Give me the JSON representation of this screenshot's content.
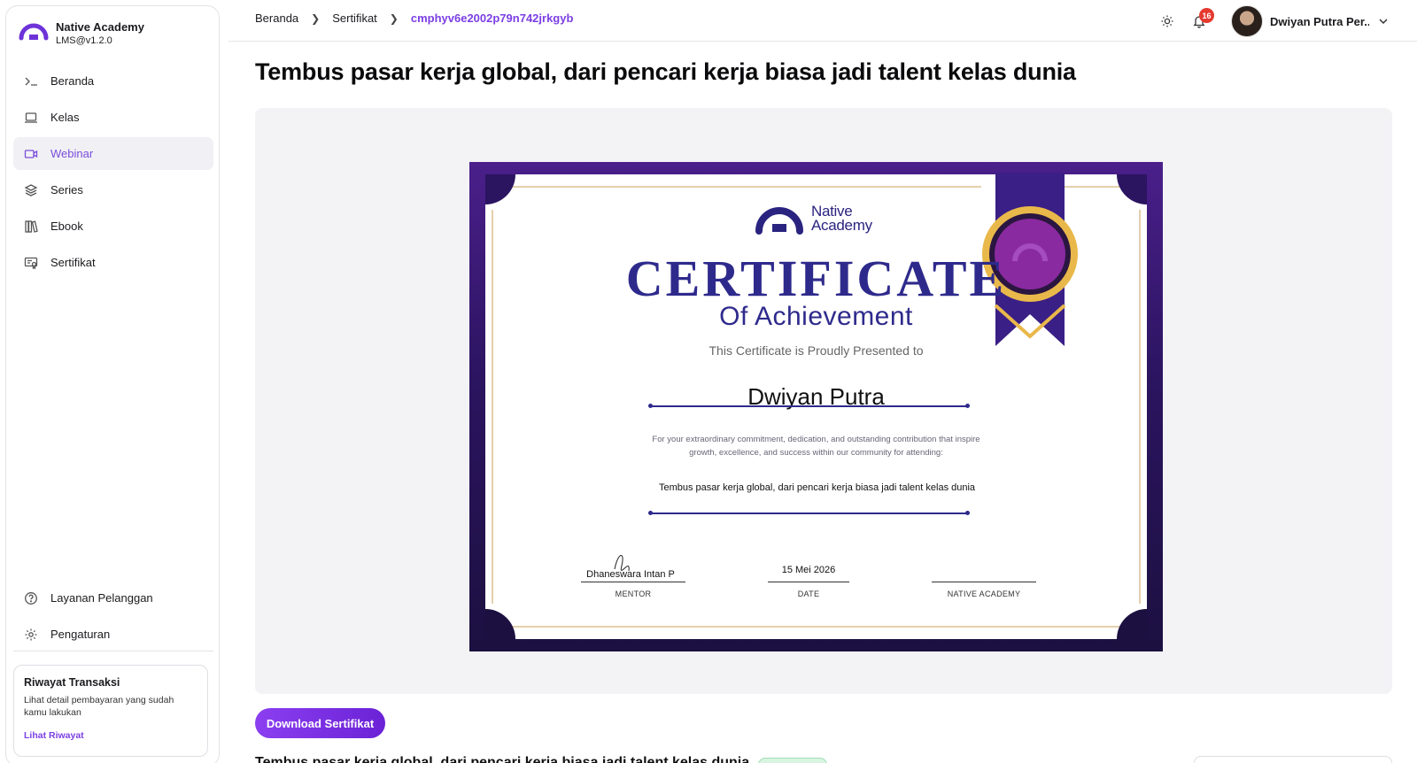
{
  "brand": {
    "name": "Native Academy",
    "version": "LMS@v1.2.0"
  },
  "sidebar": {
    "items": [
      {
        "label": "Beranda",
        "icon": "terminal-icon"
      },
      {
        "label": "Kelas",
        "icon": "laptop-icon"
      },
      {
        "label": "Webinar",
        "icon": "video-icon",
        "active": true
      },
      {
        "label": "Series",
        "icon": "layers-icon"
      },
      {
        "label": "Ebook",
        "icon": "books-icon"
      },
      {
        "label": "Sertifikat",
        "icon": "certificate-icon"
      }
    ],
    "bottom_items": [
      {
        "label": "Layanan Pelanggan",
        "icon": "help-circle-icon"
      },
      {
        "label": "Pengaturan",
        "icon": "gear-icon"
      }
    ],
    "transactions": {
      "title": "Riwayat Transaksi",
      "description": "Lihat detail pembayaran yang sudah kamu lakukan",
      "link": "Lihat Riwayat"
    }
  },
  "header": {
    "breadcrumb": [
      "Beranda",
      "Sertifikat",
      "cmphyv6e2002p79n742jrkgyb"
    ],
    "notifications": "16",
    "user_name": "Dwiyan Putra Per..."
  },
  "main": {
    "title": "Tembus pasar kerja global, dari pencari kerja biasa jadi talent kelas dunia",
    "download_label": "Download Sertifikat",
    "peek_text": "Tembus pasar kerja global, dari pencari kerja biasa jadi talent kelas dunia"
  },
  "certificate": {
    "logo_line1": "Native",
    "logo_line2": "Academy",
    "title": "CERTIFICATE",
    "subtitle": "Of Achievement",
    "presented": "This Certificate is Proudly Presented to",
    "recipient": "Dwiyan Putra",
    "description": "For your extraordinary commitment, dedication, and outstanding contribution that inspire growth, excellence, and success within our community for attending:",
    "event": "Tembus pasar kerja global, dari pencari kerja biasa jadi talent kelas dunia",
    "mentor_name": "Dhaneswara Intan P",
    "mentor_label": "MENTOR",
    "date": "15 Mei 2026",
    "date_label": "DATE",
    "org_label": "NATIVE ACADEMY"
  },
  "colors": {
    "accent": "#7b3fe4",
    "cert_navy": "#2e2a8c",
    "cert_purple": "#4a1f8a",
    "gold": "#e9b84a",
    "badge": "#e5392f"
  }
}
